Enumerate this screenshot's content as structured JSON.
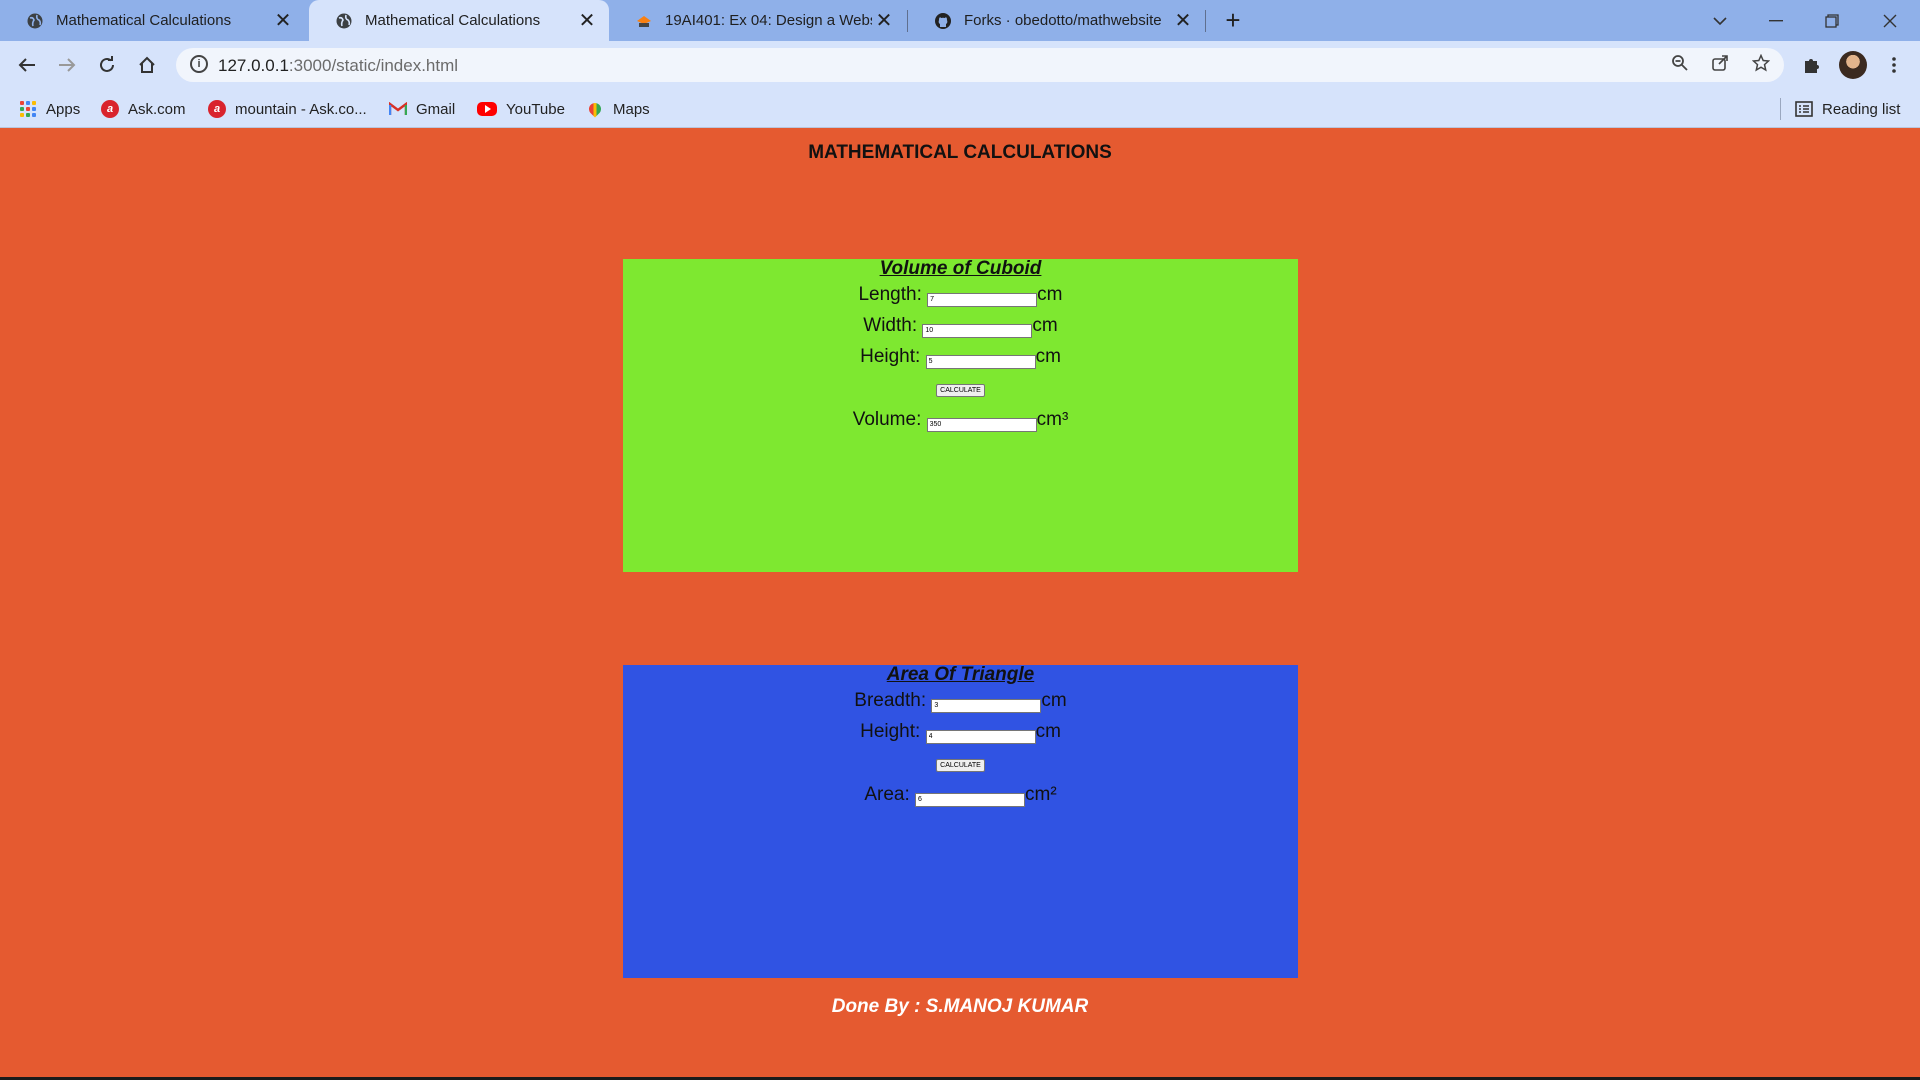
{
  "browser": {
    "tabs": [
      {
        "title": "Mathematical Calculations",
        "icon": "globe-icon",
        "active": false
      },
      {
        "title": "Mathematical Calculations",
        "icon": "globe-icon",
        "active": true
      },
      {
        "title": "19AI401: Ex 04: Design a Website",
        "icon": "moodle-icon",
        "active": false
      },
      {
        "title": "Forks · obedotto/mathwebsite",
        "icon": "github-icon",
        "active": false
      }
    ],
    "close_glyph": "✕",
    "new_tab_glyph": "+",
    "url_host": "127.0.0.1",
    "url_path": ":3000/static/index.html",
    "bookmarks": [
      {
        "label": "Apps",
        "icon": "apps-grid-icon"
      },
      {
        "label": "Ask.com",
        "icon": "ask-icon"
      },
      {
        "label": "mountain - Ask.co...",
        "icon": "ask-icon"
      },
      {
        "label": "Gmail",
        "icon": "gmail-icon"
      },
      {
        "label": "YouTube",
        "icon": "youtube-icon"
      },
      {
        "label": "Maps",
        "icon": "maps-icon"
      }
    ],
    "reading_list": "Reading list"
  },
  "page": {
    "title": "MATHEMATICAL CALCULATIONS",
    "background": "#e55a30",
    "cuboid": {
      "heading": "Volume of Cuboid",
      "background": "#7ee830",
      "length_label": "Length:",
      "length_value": "7",
      "width_label": "Width:",
      "width_value": "10",
      "height_label": "Height:",
      "height_value": "5",
      "unit": "cm",
      "button": "CALCULATE",
      "volume_label": "Volume:",
      "volume_value": "350",
      "volume_unit": "cm³"
    },
    "triangle": {
      "heading": "Area Of Triangle",
      "background": "#3053e3",
      "breadth_label": "Breadth:",
      "breadth_value": "3",
      "height_label": "Height:",
      "height_value": "4",
      "unit": "cm",
      "button": "CALCULATE",
      "area_label": "Area:",
      "area_value": "6",
      "area_unit": "cm²"
    },
    "footer": "Done By : S.MANOJ KUMAR"
  }
}
